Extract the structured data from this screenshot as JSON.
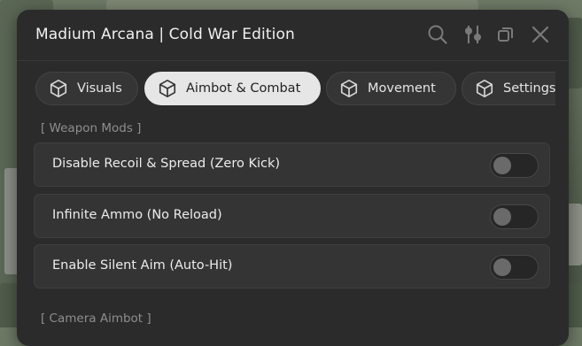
{
  "window": {
    "title": "Madium Arcana | Cold War Edition",
    "icons": [
      "search-icon",
      "sliders-icon",
      "restore-icon",
      "close-icon"
    ]
  },
  "tabs": [
    {
      "label": "Visuals",
      "icon": "cube-icon",
      "active": false
    },
    {
      "label": "Aimbot & Combat",
      "icon": "cube-icon",
      "active": true
    },
    {
      "label": "Movement",
      "icon": "cube-icon",
      "active": false
    },
    {
      "label": "Settings",
      "icon": "cube-icon",
      "active": false
    }
  ],
  "sections": [
    {
      "label": "[ Weapon Mods ]",
      "options": [
        {
          "label": "Disable Recoil & Spread (Zero Kick)",
          "enabled": false
        },
        {
          "label": "Infinite Ammo (No Reload)",
          "enabled": false
        },
        {
          "label": "Enable Silent Aim (Auto-Hit)",
          "enabled": false
        }
      ]
    },
    {
      "label": "[ Camera Aimbot ]",
      "options": []
    }
  ],
  "colors": {
    "panel": "#2b2b2b",
    "row": "#343434",
    "active_tab": "#e6e6e6",
    "text": "#ececec",
    "muted": "#8e8e8e"
  }
}
